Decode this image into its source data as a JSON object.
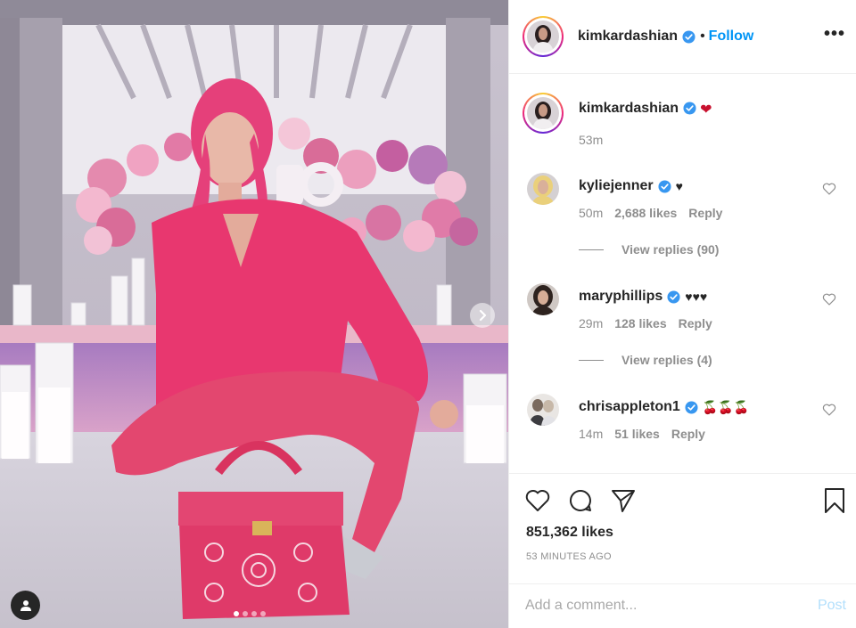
{
  "post": {
    "author": "kimkardashian",
    "follow_label": "Follow",
    "separator": "•",
    "more_label": "•••",
    "caption": {
      "username": "kimkardashian",
      "text": "❤",
      "time": "53m"
    },
    "comments": [
      {
        "username": "kyliejenner",
        "text": "♥",
        "time": "50m",
        "likes": "2,688 likes",
        "reply_label": "Reply",
        "replies": "View replies (90)"
      },
      {
        "username": "maryphillips",
        "text": "♥♥♥",
        "time": "29m",
        "likes": "128 likes",
        "reply_label": "Reply",
        "replies": "View replies (4)"
      },
      {
        "username": "chrisappleton1",
        "text": "🍒🍒🍒",
        "time": "14m",
        "likes": "51 likes",
        "reply_label": "Reply"
      }
    ],
    "likes": "851,362 likes",
    "time_ago": "53 MINUTES AGO",
    "comment_placeholder": "Add a comment...",
    "post_label": "Post"
  },
  "carousel": {
    "count": 4,
    "active": 1
  },
  "icons": {
    "verified": "verified-badge-icon",
    "like": "heart-outline-icon",
    "comment": "comment-bubble-icon",
    "share": "paper-plane-icon",
    "save": "bookmark-icon",
    "tag": "user-tag-icon",
    "next": "chevron-right-icon"
  },
  "colors": {
    "accent": "#0095f6",
    "post_disabled": "#b2dffc",
    "muted": "#8e8e8e",
    "text": "#262626"
  }
}
